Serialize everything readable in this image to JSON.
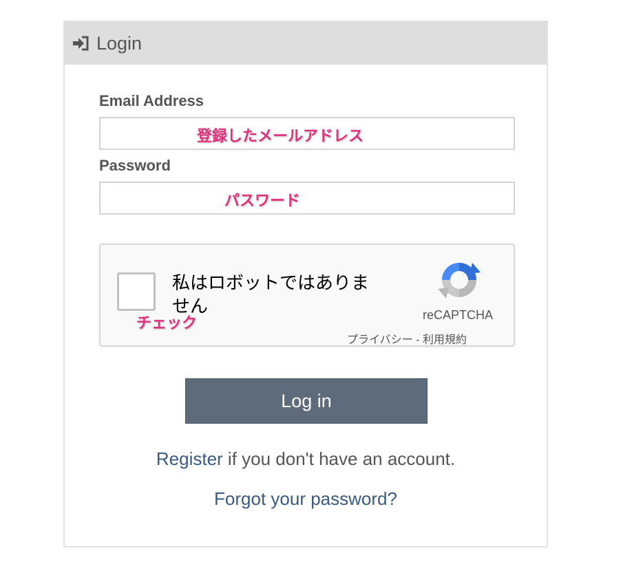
{
  "header": {
    "title": "Login",
    "icon": "sign-in-icon"
  },
  "form": {
    "email_label": "Email Address",
    "email_value": "",
    "email_annotation": "登録したメールアドレス",
    "password_label": "Password",
    "password_value": "",
    "password_annotation": "パスワード"
  },
  "recaptcha": {
    "checkbox_text": "私はロボットではありません",
    "checked": false,
    "brand": "reCAPTCHA",
    "links": "プライバシー - 利用規約",
    "check_annotation": "チェック"
  },
  "login_button_label": "Log in",
  "register": {
    "link_text": "Register",
    "suffix": " if you don't have an account."
  },
  "forgot_password": "Forgot your password?",
  "colors": {
    "header_bg": "#dedede",
    "button_bg": "#5e6b7a",
    "link": "#3a5a80",
    "annotation": "#e0327a"
  }
}
